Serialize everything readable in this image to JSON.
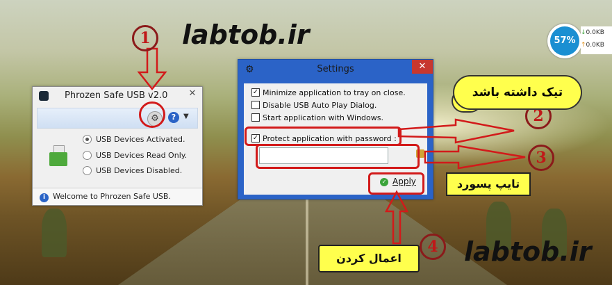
{
  "watermark": {
    "text": "labtob.ir"
  },
  "phrozen": {
    "title": "Phrozen Safe USB v2.0",
    "close": "✕",
    "radios": [
      "USB Devices Activated.",
      "USB Devices Read Only.",
      "USB Devices Disabled."
    ],
    "selected": 0,
    "status": "Welcome to Phrozen Safe USB."
  },
  "settings": {
    "title": "Settings",
    "close": "✕",
    "options": [
      {
        "label": "Minimize application to tray on close.",
        "checked": true
      },
      {
        "label": "Disable USB Auto Play Dialog.",
        "checked": false
      },
      {
        "label": "Start application with Windows.",
        "checked": false
      },
      {
        "label": "Protect application with password :",
        "checked": true
      }
    ],
    "password_value": "",
    "apply": "Apply"
  },
  "annotations": {
    "step1": "1",
    "step2": "2",
    "step3": "3",
    "step4": "4",
    "note_tick": "تیک داشته باشد",
    "note_type_password": "تایپ پسورد",
    "note_apply": "اعمال کردن"
  },
  "gauge": {
    "percent": "57%",
    "down": "0.0KB",
    "up": "0.0KB"
  },
  "colors": {
    "accent": "#2b63c7",
    "annotation_red": "#d21a1a",
    "note_yellow": "#ffff4d"
  }
}
